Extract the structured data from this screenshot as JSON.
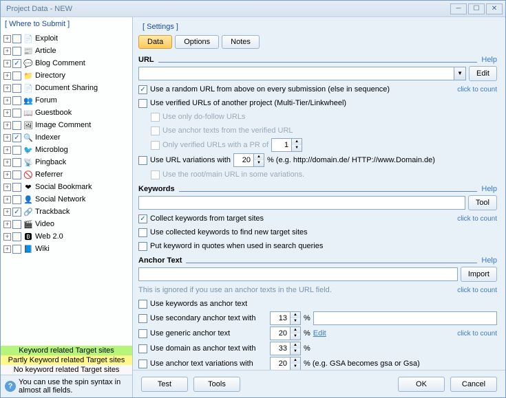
{
  "window": {
    "title": "Project Data - NEW"
  },
  "left": {
    "header": "[ Where to Submit ]",
    "items": [
      {
        "label": "Exploit",
        "checked": false,
        "icon": "📄",
        "icon_name": "page-icon"
      },
      {
        "label": "Article",
        "checked": false,
        "icon": "📰",
        "icon_name": "article-icon"
      },
      {
        "label": "Blog Comment",
        "checked": true,
        "icon": "💬",
        "icon_name": "comment-icon"
      },
      {
        "label": "Directory",
        "checked": false,
        "icon": "📁",
        "icon_name": "folder-icon"
      },
      {
        "label": "Document Sharing",
        "checked": false,
        "icon": "📄",
        "icon_name": "document-icon"
      },
      {
        "label": "Forum",
        "checked": false,
        "icon": "👥",
        "icon_name": "forum-icon"
      },
      {
        "label": "Guestbook",
        "checked": false,
        "icon": "📖",
        "icon_name": "book-icon"
      },
      {
        "label": "Image Comment",
        "checked": false,
        "icon": "🖼",
        "icon_name": "image-icon"
      },
      {
        "label": "Indexer",
        "checked": true,
        "icon": "🔍",
        "icon_name": "indexer-icon"
      },
      {
        "label": "Microblog",
        "checked": false,
        "icon": "🐦",
        "icon_name": "microblog-icon"
      },
      {
        "label": "Pingback",
        "checked": false,
        "icon": "📡",
        "icon_name": "pingback-icon"
      },
      {
        "label": "Referrer",
        "checked": false,
        "icon": "🚫",
        "icon_name": "referrer-icon"
      },
      {
        "label": "Social Bookmark",
        "checked": false,
        "icon": "❤",
        "icon_name": "bookmark-icon"
      },
      {
        "label": "Social Network",
        "checked": false,
        "icon": "👤",
        "icon_name": "social-icon"
      },
      {
        "label": "Trackback",
        "checked": true,
        "icon": "🔗",
        "icon_name": "trackback-icon"
      },
      {
        "label": "Video",
        "checked": false,
        "icon": "🎬",
        "icon_name": "video-icon"
      },
      {
        "label": "Web 2.0",
        "checked": false,
        "icon": "🅱",
        "icon_name": "web20-icon"
      },
      {
        "label": "Wiki",
        "checked": false,
        "icon": "📘",
        "icon_name": "wiki-icon"
      }
    ],
    "legend": {
      "l1": "Keyword related Target sites",
      "l2": "Partly Keyword related Target sites",
      "l3": "No keyword related Target sites"
    },
    "hint": "You can use the spin syntax in almost all fields."
  },
  "right": {
    "header": "[ Settings ]",
    "tabs": {
      "data": "Data",
      "options": "Options",
      "notes": "Notes"
    },
    "help": "Help",
    "ctc": "click to count",
    "url": {
      "title": "URL",
      "edit": "Edit",
      "random": "Use a random URL from above on every submission (else in sequence)",
      "verified": "Use verified URLs of another project (Multi-Tier/Linkwheel)",
      "dofollow": "Use only do-follow URLs",
      "anchor_from_verified": "Use anchor texts from the verified URL",
      "pr_of": "Only verified URLs with a PR of",
      "pr_val": "1",
      "variations": "Use URL variations with",
      "variations_val": "20",
      "variations_eg": "% (e.g. http://domain.de/ HTTP://www.Domain.de)",
      "root": "Use the root/main URL in some variations."
    },
    "keywords": {
      "title": "Keywords",
      "tool": "Tool",
      "collect": "Collect keywords from target sites",
      "use_collected": "Use collected keywords to find new target sites",
      "quotes": "Put keyword in quotes when used in search queries"
    },
    "anchor": {
      "title": "Anchor Text",
      "import": "Import",
      "ignored": "This is ignored if you use an anchor texts in the URL field.",
      "use_keywords": "Use keywords as anchor text",
      "secondary": "Use secondary anchor text with",
      "secondary_val": "13",
      "generic": "Use generic anchor text",
      "generic_val": "20",
      "edit": "Edit",
      "domain": "Use domain as anchor text with",
      "domain_val": "33",
      "variations": "Use anchor text variations with",
      "variations_val": "20",
      "variations_eg": "% (e.g. GSA becomes gsa or Gsa)",
      "pct": "%"
    }
  },
  "footer": {
    "test": "Test",
    "tools": "Tools",
    "ok": "OK",
    "cancel": "Cancel"
  }
}
